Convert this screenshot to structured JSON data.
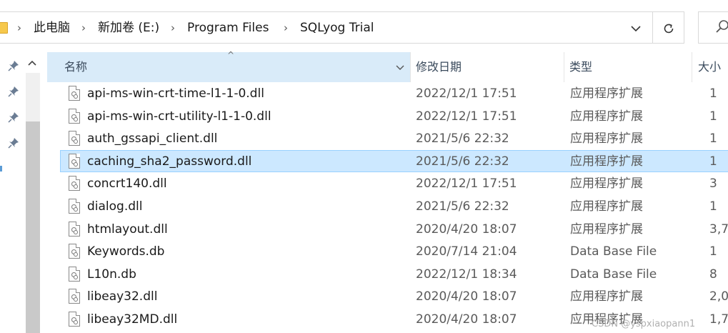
{
  "address_bar": {
    "breadcrumbs": [
      "此电脑",
      "新加卷 (E:)",
      "Program Files",
      "SQLyog Trial"
    ],
    "separator": "›",
    "dropdown_icon": "chevron-down-icon",
    "refresh_icon": "refresh-icon",
    "search_icon": "search-icon"
  },
  "columns": {
    "name": "名称",
    "date": "修改日期",
    "type": "类型",
    "size": "大小"
  },
  "files": [
    {
      "name": "api-ms-win-crt-time-l1-1-0.dll",
      "date": "2022/12/1 17:51",
      "type": "应用程序扩展",
      "size": "1",
      "selected": false
    },
    {
      "name": "api-ms-win-crt-utility-l1-1-0.dll",
      "date": "2022/12/1 17:51",
      "type": "应用程序扩展",
      "size": "1",
      "selected": false
    },
    {
      "name": "auth_gssapi_client.dll",
      "date": "2021/5/6 22:32",
      "type": "应用程序扩展",
      "size": "1",
      "selected": false
    },
    {
      "name": "caching_sha2_password.dll",
      "date": "2021/5/6 22:32",
      "type": "应用程序扩展",
      "size": "1",
      "selected": true
    },
    {
      "name": "concrt140.dll",
      "date": "2022/12/1 17:51",
      "type": "应用程序扩展",
      "size": "3",
      "selected": false
    },
    {
      "name": "dialog.dll",
      "date": "2021/5/6 22:32",
      "type": "应用程序扩展",
      "size": "1",
      "selected": false
    },
    {
      "name": "htmlayout.dll",
      "date": "2020/4/20 18:07",
      "type": "应用程序扩展",
      "size": "3,7",
      "selected": false
    },
    {
      "name": "Keywords.db",
      "date": "2020/7/14 21:04",
      "type": "Data Base File",
      "size": "1",
      "selected": false
    },
    {
      "name": "L10n.db",
      "date": "2022/12/1 18:34",
      "type": "Data Base File",
      "size": "8",
      "selected": false
    },
    {
      "name": "libeay32.dll",
      "date": "2020/4/20 18:07",
      "type": "应用程序扩展",
      "size": "2,0",
      "selected": false
    },
    {
      "name": "libeay32MD.dll",
      "date": "2020/4/20 18:07",
      "type": "应用程序扩展",
      "size": "1,7",
      "selected": false
    }
  ],
  "watermark": "CSDN @yspxiaopann1",
  "colors": {
    "selection_fill": "#cce8ff",
    "selection_border": "#99d1ff",
    "header_highlight": "#d9ebf9",
    "folder_yellow": "#f6c84c"
  }
}
